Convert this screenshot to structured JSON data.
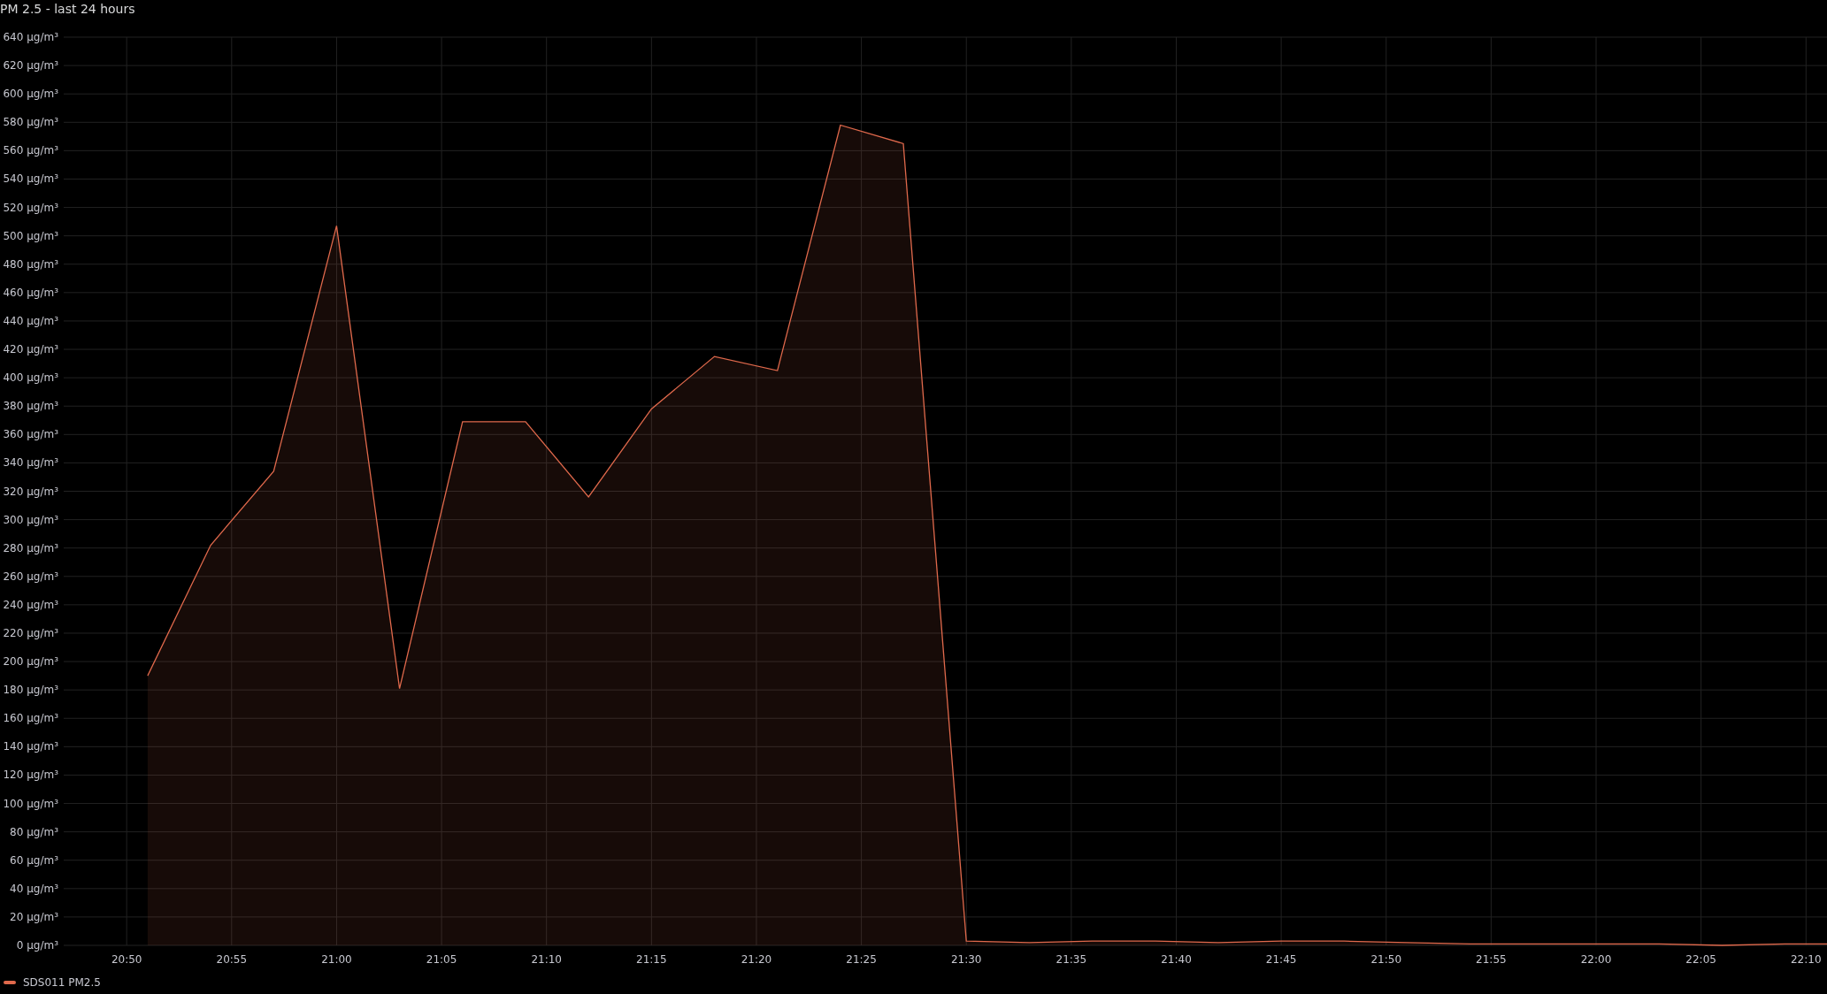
{
  "panel": {
    "title": "PM 2.5 - last 24 hours",
    "chart_data": {
      "type": "area",
      "x": [
        1251,
        1254,
        1257,
        1260,
        1263,
        1266,
        1269,
        1272,
        1275,
        1278,
        1281,
        1284,
        1287,
        1290,
        1293,
        1296,
        1299,
        1302,
        1305,
        1308,
        1311,
        1314,
        1317,
        1320,
        1323,
        1326,
        1329,
        1331
      ],
      "series": [
        {
          "name": "SDS011 PM2.5",
          "color": "#e0694c",
          "values": [
            190,
            282,
            334,
            507,
            181,
            369,
            369,
            316,
            378,
            415,
            405,
            578,
            565,
            3,
            2,
            3,
            3,
            2,
            3,
            3,
            2,
            1,
            1,
            1,
            1,
            0,
            1,
            1
          ]
        }
      ],
      "grid": true,
      "xlim": [
        1247,
        1331
      ],
      "ylim": [
        0,
        640
      ],
      "xticks": [
        {
          "value": 1250,
          "label": "20:50"
        },
        {
          "value": 1255,
          "label": "20:55"
        },
        {
          "value": 1260,
          "label": "21:00"
        },
        {
          "value": 1265,
          "label": "21:05"
        },
        {
          "value": 1270,
          "label": "21:10"
        },
        {
          "value": 1275,
          "label": "21:15"
        },
        {
          "value": 1280,
          "label": "21:20"
        },
        {
          "value": 1285,
          "label": "21:25"
        },
        {
          "value": 1290,
          "label": "21:30"
        },
        {
          "value": 1295,
          "label": "21:35"
        },
        {
          "value": 1300,
          "label": "21:40"
        },
        {
          "value": 1305,
          "label": "21:45"
        },
        {
          "value": 1310,
          "label": "21:50"
        },
        {
          "value": 1315,
          "label": "21:55"
        },
        {
          "value": 1320,
          "label": "22:00"
        },
        {
          "value": 1325,
          "label": "22:05"
        },
        {
          "value": 1330,
          "label": "22:10"
        }
      ],
      "yticks": [
        {
          "value": 0,
          "label": "0 µg/m³"
        },
        {
          "value": 20,
          "label": "20 µg/m³"
        },
        {
          "value": 40,
          "label": "40 µg/m³"
        },
        {
          "value": 60,
          "label": "60 µg/m³"
        },
        {
          "value": 80,
          "label": "80 µg/m³"
        },
        {
          "value": 100,
          "label": "100 µg/m³"
        },
        {
          "value": 120,
          "label": "120 µg/m³"
        },
        {
          "value": 140,
          "label": "140 µg/m³"
        },
        {
          "value": 160,
          "label": "160 µg/m³"
        },
        {
          "value": 180,
          "label": "180 µg/m³"
        },
        {
          "value": 200,
          "label": "200 µg/m³"
        },
        {
          "value": 220,
          "label": "220 µg/m³"
        },
        {
          "value": 240,
          "label": "240 µg/m³"
        },
        {
          "value": 260,
          "label": "260 µg/m³"
        },
        {
          "value": 280,
          "label": "280 µg/m³"
        },
        {
          "value": 300,
          "label": "300 µg/m³"
        },
        {
          "value": 320,
          "label": "320 µg/m³"
        },
        {
          "value": 340,
          "label": "340 µg/m³"
        },
        {
          "value": 360,
          "label": "360 µg/m³"
        },
        {
          "value": 380,
          "label": "380 µg/m³"
        },
        {
          "value": 400,
          "label": "400 µg/m³"
        },
        {
          "value": 420,
          "label": "420 µg/m³"
        },
        {
          "value": 440,
          "label": "440 µg/m³"
        },
        {
          "value": 460,
          "label": "460 µg/m³"
        },
        {
          "value": 480,
          "label": "480 µg/m³"
        },
        {
          "value": 500,
          "label": "500 µg/m³"
        },
        {
          "value": 520,
          "label": "520 µg/m³"
        },
        {
          "value": 540,
          "label": "540 µg/m³"
        },
        {
          "value": 560,
          "label": "560 µg/m³"
        },
        {
          "value": 580,
          "label": "580 µg/m³"
        },
        {
          "value": 600,
          "label": "600 µg/m³"
        },
        {
          "value": 620,
          "label": "620 µg/m³"
        },
        {
          "value": 640,
          "label": "640 µg/m³"
        }
      ]
    }
  }
}
